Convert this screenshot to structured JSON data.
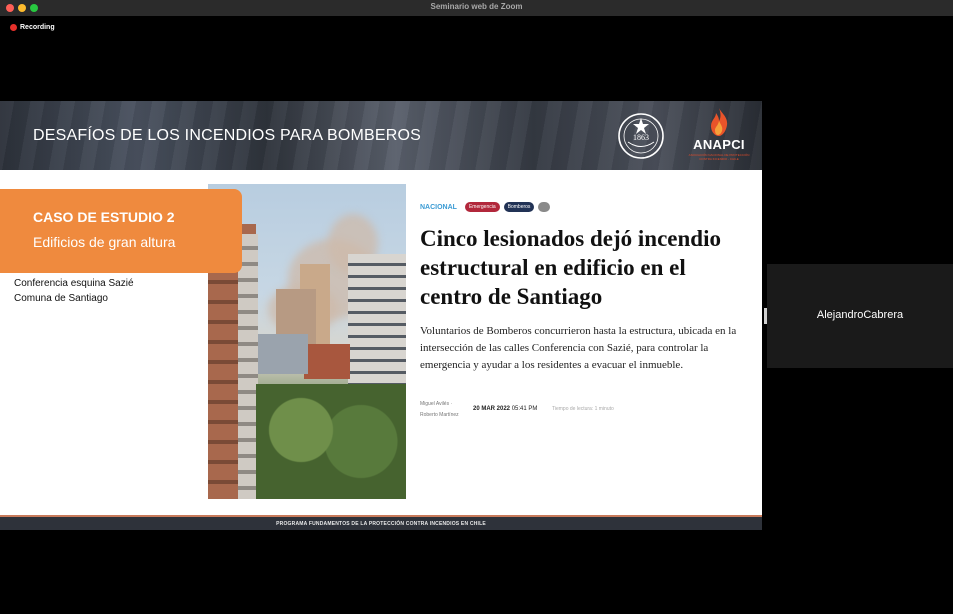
{
  "window": {
    "title": "Seminario web de Zoom",
    "recording_label": "Recording"
  },
  "slide": {
    "header_title": "DESAFÍOS DE LOS INCENDIOS PARA BOMBEROS",
    "logo_left_text": "1863",
    "logo_right_name": "ANAPCI",
    "logo_right_sub": "ASOCIACIÓN NACIONAL DE PROTECCIÓN CONTRA INCENDIO - CHILE",
    "case_title": "CASO DE ESTUDIO 2",
    "case_subtitle": "Edificios de gran altura",
    "location_line1": "Conferencia esquina Sazié",
    "location_line2": "Comuna de Santiago",
    "footer": "PROGRAMA FUNDAMENTOS DE LA PROTECCIÓN CONTRA INCENDIOS EN CHILE"
  },
  "article": {
    "section": "NACIONAL",
    "tags": [
      "Emergencia",
      "Bomberos"
    ],
    "headline": "Cinco lesionados dejó incendio estructural en edificio en el centro de Santiago",
    "dek": "Voluntarios de Bomberos concurrieron hasta la estructura, ubicada en la intersección de las calles Conferencia con Sazié, para controlar la emergencia y ayudar a los residentes a evacuar el inmueble.",
    "author_line1": "Miguel Avilés ·",
    "author_line2": "Roberto Martínez",
    "date": "20 MAR 2022",
    "time": "05:41 PM",
    "read_time": "Tiempo de lectura: 1 minuto"
  },
  "participant": {
    "name": "AlejandroCabrera"
  },
  "colors": {
    "accent_orange": "#ef8a3e",
    "recording_red": "#e5302a",
    "section_blue": "#3b9bd4",
    "tag_red": "#b2273b",
    "tag_navy": "#213255"
  }
}
